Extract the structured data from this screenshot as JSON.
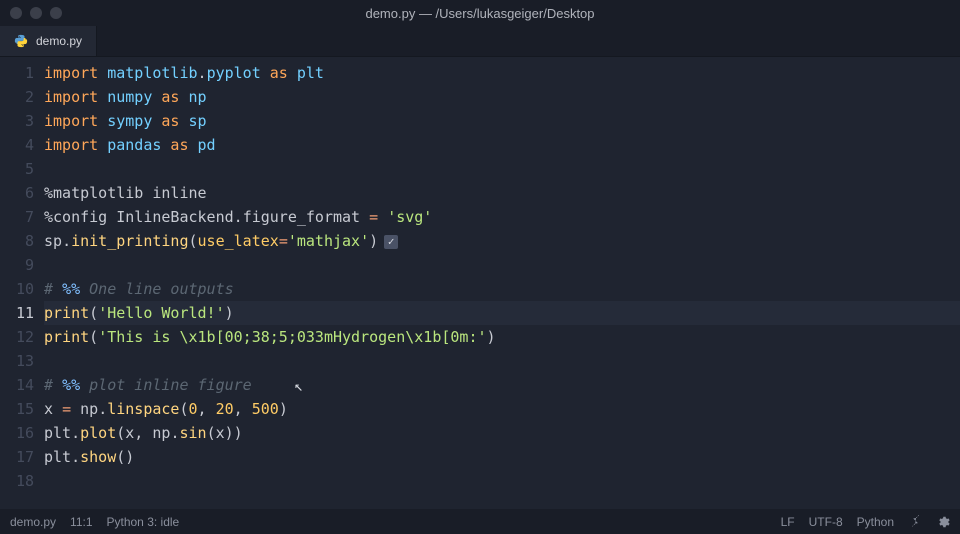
{
  "window": {
    "title": "demo.py — /Users/lukasgeiger/Desktop"
  },
  "tab": {
    "label": "demo.py"
  },
  "editor": {
    "active_line": 11,
    "lines": [
      {
        "n": 1,
        "tokens": [
          {
            "t": "import ",
            "c": "kw"
          },
          {
            "t": "matplotlib",
            "c": "mod"
          },
          {
            "t": ".",
            "c": "punc"
          },
          {
            "t": "pyplot",
            "c": "mod"
          },
          {
            "t": " as ",
            "c": "kw"
          },
          {
            "t": "plt",
            "c": "mod"
          }
        ]
      },
      {
        "n": 2,
        "tokens": [
          {
            "t": "import ",
            "c": "kw"
          },
          {
            "t": "numpy",
            "c": "mod"
          },
          {
            "t": " as ",
            "c": "kw"
          },
          {
            "t": "np",
            "c": "mod"
          }
        ]
      },
      {
        "n": 3,
        "tokens": [
          {
            "t": "import ",
            "c": "kw"
          },
          {
            "t": "sympy",
            "c": "mod"
          },
          {
            "t": " as ",
            "c": "kw"
          },
          {
            "t": "sp",
            "c": "mod"
          }
        ]
      },
      {
        "n": 4,
        "tokens": [
          {
            "t": "import ",
            "c": "kw"
          },
          {
            "t": "pandas",
            "c": "mod"
          },
          {
            "t": " as ",
            "c": "kw"
          },
          {
            "t": "pd",
            "c": "mod"
          }
        ]
      },
      {
        "n": 5,
        "tokens": []
      },
      {
        "n": 6,
        "tokens": [
          {
            "t": "%matplotlib inline",
            "c": "plain"
          }
        ]
      },
      {
        "n": 7,
        "tokens": [
          {
            "t": "%config InlineBackend",
            "c": "plain"
          },
          {
            "t": ".",
            "c": "punc"
          },
          {
            "t": "figure_format ",
            "c": "plain"
          },
          {
            "t": "= ",
            "c": "op"
          },
          {
            "t": "'svg'",
            "c": "str"
          }
        ]
      },
      {
        "n": 8,
        "tokens": [
          {
            "t": "sp",
            "c": "plain"
          },
          {
            "t": ".",
            "c": "punc"
          },
          {
            "t": "init_printing",
            "c": "fn"
          },
          {
            "t": "(",
            "c": "punc"
          },
          {
            "t": "use_latex",
            "c": "named"
          },
          {
            "t": "=",
            "c": "op"
          },
          {
            "t": "'mathjax'",
            "c": "str"
          },
          {
            "t": ")",
            "c": "punc"
          }
        ],
        "check": true
      },
      {
        "n": 9,
        "tokens": []
      },
      {
        "n": 10,
        "tokens": [
          {
            "t": "# ",
            "c": "cmt"
          },
          {
            "t": "%%",
            "c": "cell"
          },
          {
            "t": " One line outputs",
            "c": "cmt"
          }
        ]
      },
      {
        "n": 11,
        "tokens": [
          {
            "t": "print",
            "c": "fn"
          },
          {
            "t": "(",
            "c": "punc"
          },
          {
            "t": "'Hello World!'",
            "c": "str"
          },
          {
            "t": ")",
            "c": "punc"
          }
        ]
      },
      {
        "n": 12,
        "tokens": [
          {
            "t": "print",
            "c": "fn"
          },
          {
            "t": "(",
            "c": "punc"
          },
          {
            "t": "'This is \\x1b[00;38;5;033mHydrogen\\x1b[0m:'",
            "c": "str"
          },
          {
            "t": ")",
            "c": "punc"
          }
        ]
      },
      {
        "n": 13,
        "tokens": []
      },
      {
        "n": 14,
        "tokens": [
          {
            "t": "# ",
            "c": "cmt"
          },
          {
            "t": "%%",
            "c": "cell"
          },
          {
            "t": " plot inline figure",
            "c": "cmt"
          }
        ]
      },
      {
        "n": 15,
        "tokens": [
          {
            "t": "x ",
            "c": "plain"
          },
          {
            "t": "= ",
            "c": "op"
          },
          {
            "t": "np",
            "c": "plain"
          },
          {
            "t": ".",
            "c": "punc"
          },
          {
            "t": "linspace",
            "c": "fn"
          },
          {
            "t": "(",
            "c": "punc"
          },
          {
            "t": "0",
            "c": "num"
          },
          {
            "t": ", ",
            "c": "punc"
          },
          {
            "t": "20",
            "c": "num"
          },
          {
            "t": ", ",
            "c": "punc"
          },
          {
            "t": "500",
            "c": "num"
          },
          {
            "t": ")",
            "c": "punc"
          }
        ]
      },
      {
        "n": 16,
        "tokens": [
          {
            "t": "plt",
            "c": "plain"
          },
          {
            "t": ".",
            "c": "punc"
          },
          {
            "t": "plot",
            "c": "fn"
          },
          {
            "t": "(x, np",
            "c": "plain"
          },
          {
            "t": ".",
            "c": "punc"
          },
          {
            "t": "sin",
            "c": "fn"
          },
          {
            "t": "(x))",
            "c": "punc"
          }
        ]
      },
      {
        "n": 17,
        "tokens": [
          {
            "t": "plt",
            "c": "plain"
          },
          {
            "t": ".",
            "c": "punc"
          },
          {
            "t": "show",
            "c": "fn"
          },
          {
            "t": "()",
            "c": "punc"
          }
        ]
      },
      {
        "n": 18,
        "tokens": []
      }
    ]
  },
  "status": {
    "file": "demo.py",
    "position": "11:1",
    "kernel": "Python 3: idle",
    "eol": "LF",
    "encoding": "UTF-8",
    "language": "Python"
  }
}
